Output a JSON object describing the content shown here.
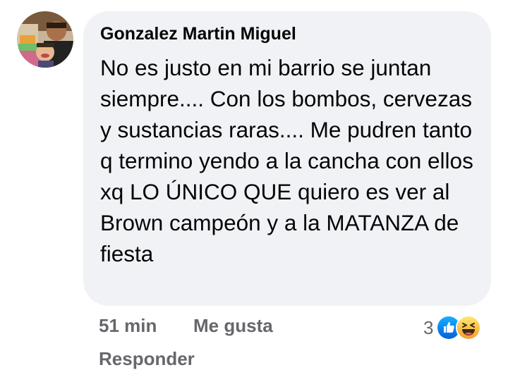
{
  "comment": {
    "author": "Gonzalez Martin Miguel",
    "text": "No es justo en mi barrio se juntan siempre.... Con los bombos, cervezas y sustancias raras.... Me pudren tanto q termino yendo a la cancha con ellos xq LO ÚNICO QUE quiero es ver al Brown campeón y a la MATANZA de fiesta",
    "avatar_icon": "profile-photo"
  },
  "actions": {
    "time": "51 min",
    "like_label": "Me gusta",
    "reply_label": "Responder"
  },
  "reactions": {
    "count": "3",
    "icons": [
      "like-icon",
      "haha-icon"
    ],
    "like_color": "#1877f2",
    "haha_color": "#f7b125"
  },
  "colors": {
    "bubble": "#f0f2f5",
    "text": "#050505",
    "meta": "#65676b"
  }
}
